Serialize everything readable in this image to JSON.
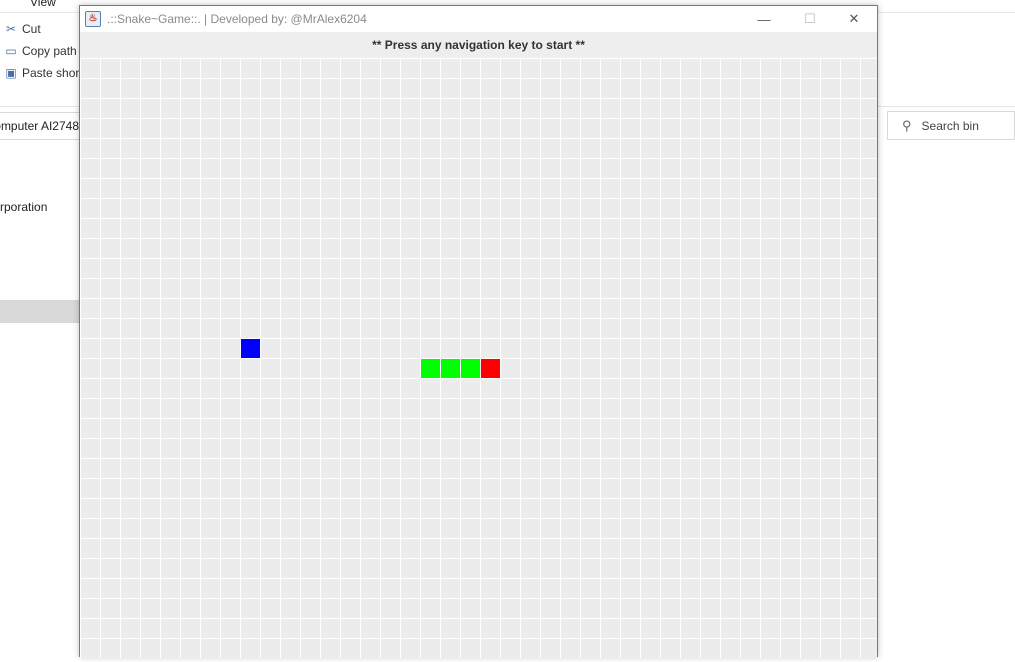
{
  "explorer": {
    "menu_view": "View",
    "cut_label": "Cut",
    "copy_path_label": "Copy path",
    "paste_shortcut_label": "Paste shortc",
    "address_text": "omputer AI2748",
    "corp_text": "rporation",
    "search_placeholder": "Search bin",
    "cut_icon": "scissors-icon",
    "copy_path_icon": "copy-path-icon",
    "paste_shortcut_icon": "paste-shortcut-icon",
    "search_icon": "magnifier-icon"
  },
  "game_window": {
    "title": ".::Snake~Game::. | Developed by: @MrAlex6204",
    "app_icon": "java-icon",
    "minimize_icon": "minimize-icon",
    "maximize_icon": "maximize-icon",
    "close_icon": "close-icon",
    "header_message": "** Press any navigation key to start **"
  },
  "game": {
    "grid_cols": 40,
    "grid_rows": 30,
    "food": {
      "col": 8,
      "row": 14,
      "color": "#0000ff"
    },
    "snake_body": [
      {
        "col": 17,
        "row": 15
      },
      {
        "col": 18,
        "row": 15
      },
      {
        "col": 19,
        "row": 15
      }
    ],
    "snake_head": {
      "col": 20,
      "row": 15
    },
    "body_color": "#00ff00",
    "head_color": "#ff0000",
    "grid_line_color": "#ffffff",
    "cell_color": "#ececec"
  }
}
